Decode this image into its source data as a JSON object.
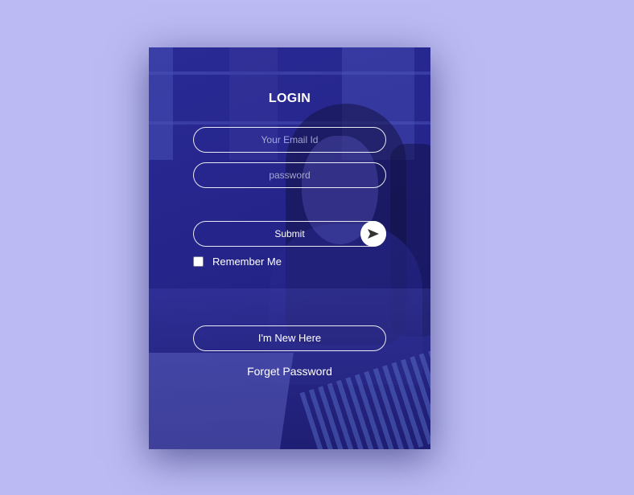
{
  "login": {
    "title": "LOGIN",
    "email_placeholder": "Your Email Id",
    "password_placeholder": "password",
    "submit_label": "Submit",
    "submit_icon": "send-arrow-icon",
    "remember_label": "Remember Me",
    "remember_checked": false,
    "new_here_label": "I'm New Here",
    "forget_label": "Forget Password"
  },
  "colors": {
    "page_background": "#bbbaf2",
    "card_tint": "#24248a",
    "text": "#ffffff"
  }
}
